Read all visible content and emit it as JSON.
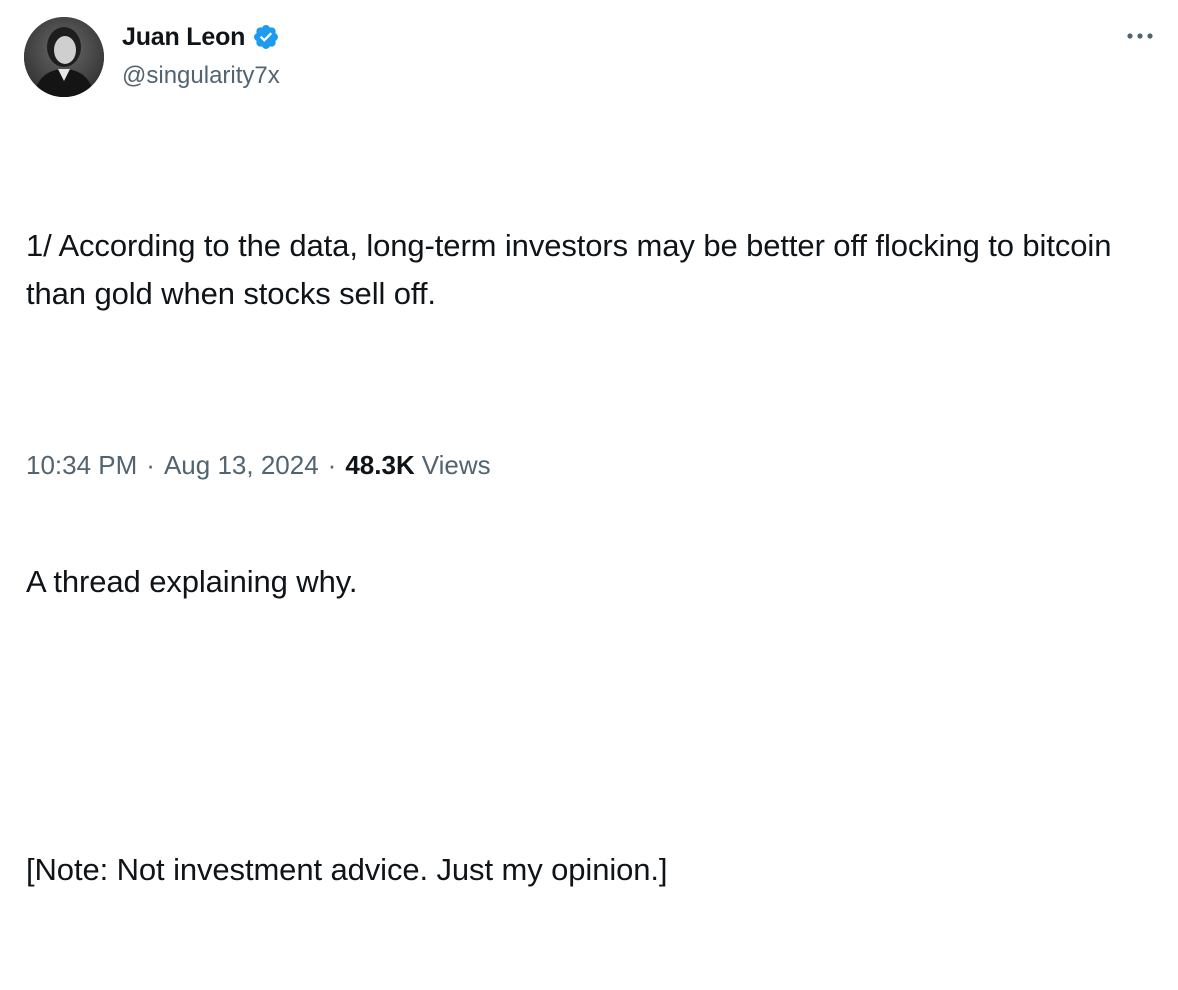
{
  "author": {
    "display_name": "Juan Leon",
    "handle": "@singularity7x",
    "verified": true,
    "verified_color": "#1d9bf0"
  },
  "tweet": {
    "paragraphs": [
      "1/ According to the data, long-term investors may be better off flocking to bitcoin than gold when stocks sell off.",
      "A thread explaining why.",
      "[Note: Not investment advice. Just my opinion.]"
    ],
    "time": "10:34 PM",
    "separator": "·",
    "date": "Aug 13, 2024",
    "views_count": "48.3K",
    "views_label": "Views"
  },
  "icons": {
    "avatar": "avatar-photo",
    "verified": "verified-badge-icon",
    "more": "more-options-icon"
  },
  "colors": {
    "text_primary": "#0f1419",
    "text_secondary": "#536471",
    "accent": "#1d9bf0",
    "background": "#ffffff"
  }
}
